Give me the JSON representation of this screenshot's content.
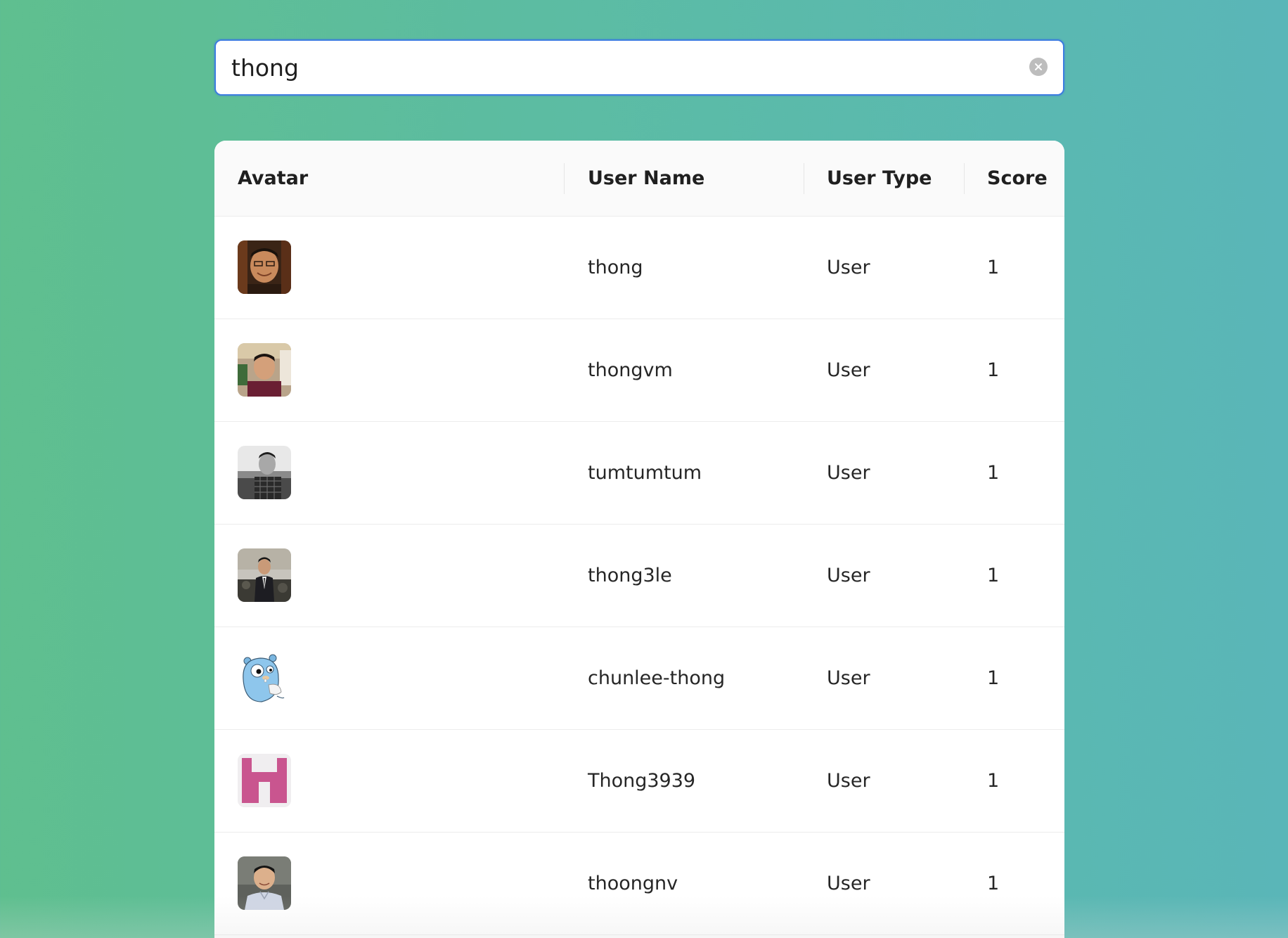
{
  "search": {
    "value": "thong",
    "clear_icon": "clear-circle-icon"
  },
  "table": {
    "columns": [
      {
        "key": "avatar",
        "label": "Avatar"
      },
      {
        "key": "user_name",
        "label": "User Name"
      },
      {
        "key": "user_type",
        "label": "User Type"
      },
      {
        "key": "score",
        "label": "Score"
      }
    ],
    "rows": [
      {
        "avatar": "photo-portrait-warm",
        "user_name": "thong",
        "user_type": "User",
        "score": "1"
      },
      {
        "avatar": "photo-portrait-indoor",
        "user_name": "thongvm",
        "user_type": "User",
        "score": "1"
      },
      {
        "avatar": "photo-portrait-bw",
        "user_name": "tumtumtum",
        "user_type": "User",
        "score": "1"
      },
      {
        "avatar": "photo-portrait-suit",
        "user_name": "thong3le",
        "user_type": "User",
        "score": "1"
      },
      {
        "avatar": "gopher-mascot",
        "user_name": "chunlee-thong",
        "user_type": "User",
        "score": "1"
      },
      {
        "avatar": "identicon-pink",
        "user_name": "Thong3939",
        "user_type": "User",
        "score": "1"
      },
      {
        "avatar": "photo-portrait-shirt",
        "user_name": "thoongnv",
        "user_type": "User",
        "score": "1"
      }
    ]
  },
  "colors": {
    "accent": "#3b7be0",
    "background_start": "#5fbf8f",
    "background_end": "#5ab6b8",
    "identicon": "#c9558f"
  }
}
